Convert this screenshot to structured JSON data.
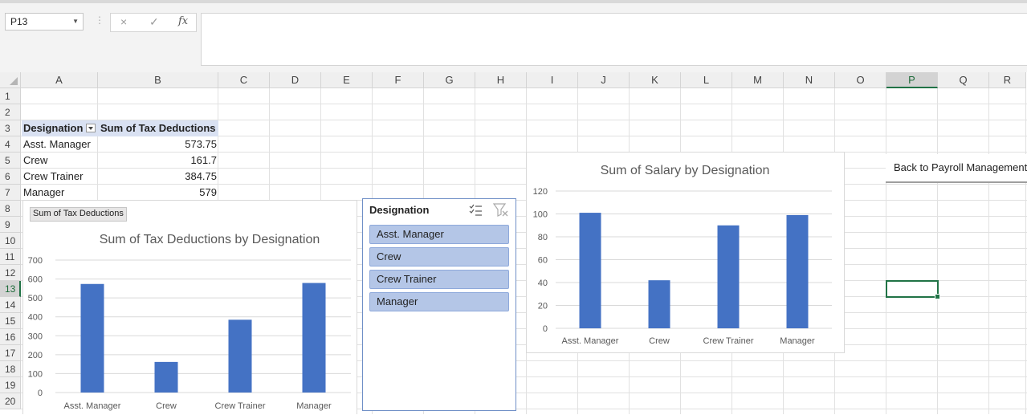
{
  "formula_bar": {
    "name_box": "P13",
    "cancel_icon": "×",
    "enter_icon": "✓",
    "fx_icon": "fx",
    "formula": ""
  },
  "columns": [
    "A",
    "B",
    "C",
    "D",
    "E",
    "F",
    "G",
    "H",
    "I",
    "J",
    "K",
    "L",
    "M",
    "N",
    "O",
    "P",
    "Q",
    "R"
  ],
  "rows": [
    "1",
    "2",
    "3",
    "4",
    "5",
    "6",
    "7",
    "8",
    "9",
    "10",
    "11",
    "12",
    "13",
    "14",
    "15",
    "16",
    "17",
    "18",
    "19",
    "20"
  ],
  "selected_cell": {
    "column": "P",
    "row": "13"
  },
  "pivot_table": {
    "header_designation": "Designation",
    "header_value": "Sum of Tax Deductions",
    "rows": [
      {
        "label": "Asst. Manager",
        "value": "573.75"
      },
      {
        "label": "Crew",
        "value": "161.7"
      },
      {
        "label": "Crew Trainer",
        "value": "384.75"
      },
      {
        "label": "Manager",
        "value": "579"
      }
    ]
  },
  "tax_chart_field_button": "Sum of Tax Deductions",
  "slicer": {
    "title": "Designation",
    "items": [
      "Asst. Manager",
      "Crew",
      "Crew Trainer",
      "Manager"
    ],
    "multiselect_icon": "multi-select-icon",
    "clear_filter_icon": "clear-filter-icon"
  },
  "macro_button": "Back to Payroll Management",
  "colors": {
    "bar": "#4472c4",
    "selection": "#217346",
    "pivot_header": "#d9e1f2"
  },
  "chart_data": [
    {
      "type": "bar",
      "title": "Sum of Tax Deductions by Designation",
      "categories": [
        "Asst. Manager",
        "Crew",
        "Crew Trainer",
        "Manager"
      ],
      "values": [
        573.75,
        161.7,
        384.75,
        579
      ],
      "ylim": [
        0,
        700
      ],
      "yticks": [
        0,
        100,
        200,
        300,
        400,
        500,
        600,
        700
      ],
      "grid": true
    },
    {
      "type": "bar",
      "title": "Sum of Salary by Designation",
      "categories": [
        "Asst. Manager",
        "Crew",
        "Crew Trainer",
        "Manager"
      ],
      "values": [
        101,
        42,
        90,
        99
      ],
      "ylim": [
        0,
        120
      ],
      "yticks": [
        0,
        20,
        40,
        60,
        80,
        100,
        120
      ],
      "grid": true
    }
  ]
}
